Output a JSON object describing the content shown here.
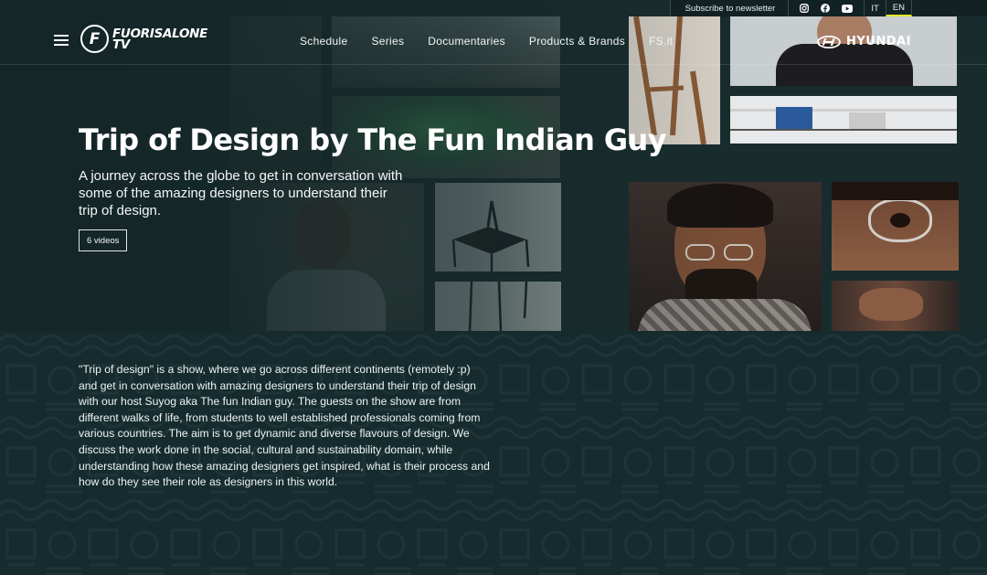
{
  "topbar": {
    "newsletter": "Subscribe to newsletter",
    "social_icons": [
      "instagram-icon",
      "facebook-icon",
      "youtube-icon"
    ],
    "languages": [
      {
        "code": "IT",
        "active": false
      },
      {
        "code": "EN",
        "active": true
      }
    ],
    "active_color": "#e6e82b"
  },
  "nav": {
    "logo_line1": "FUORISALONE",
    "logo_line2": "TV",
    "logo_mark": "F",
    "links": [
      "Schedule",
      "Series",
      "Documentaries",
      "Products & Brands",
      "FS.it"
    ],
    "sponsor": "HYUNDAI"
  },
  "hero": {
    "title": "Trip of Design by The Fun Indian Guy",
    "subtitle": "A journey across the globe to get in conversation with some of the amazing designers to understand their trip of design.",
    "video_count": "6 videos"
  },
  "description": "\"Trip of design\" is a show, where we go across different continents (remotely :p) and get in conversation with amazing designers to understand their trip of design with our host Suyog aka The fun Indian guy. The guests on the show are from different walks of life, from students to well established professionals coming from various countries. The aim is to get dynamic and diverse flavours of design. We discuss the work done in the social, cultural and sustainability domain, while understanding how these amazing designers get inspired, what is their process and how do they see their role as designers in this world.",
  "colors": {
    "background": "#16292b",
    "text": "#ffffff",
    "accent": "#e6e82b"
  }
}
